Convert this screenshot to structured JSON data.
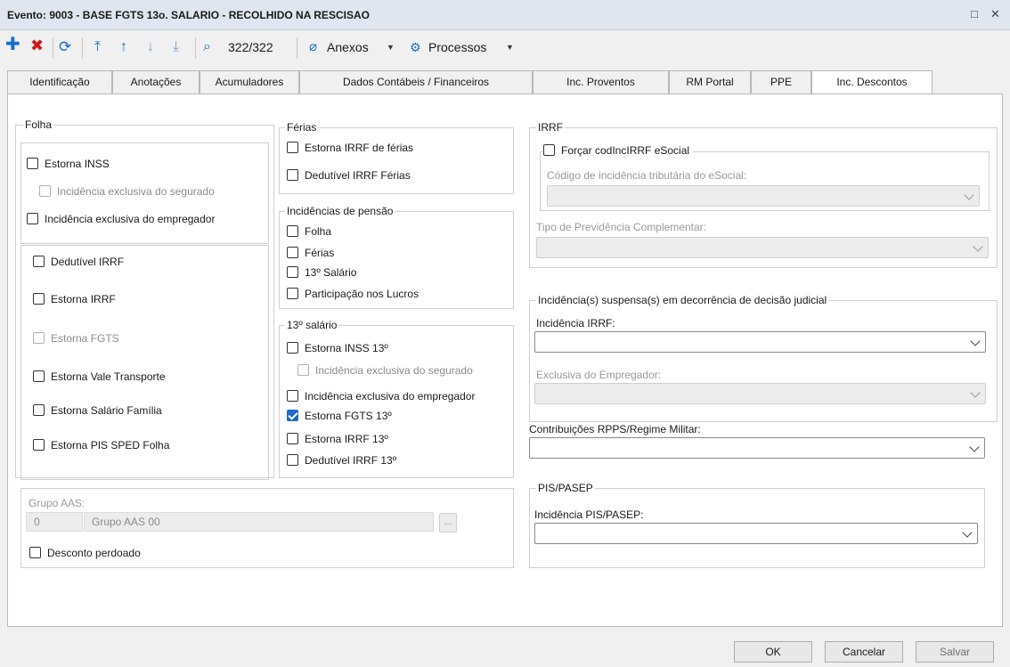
{
  "window": {
    "title": "Evento: 9003 - BASE FGTS 13o. SALARIO - RECOLHIDO NA RESCISAO",
    "maximize_glyph": "□",
    "close_glyph": "✕"
  },
  "toolbar": {
    "record_counter": "322/322",
    "anexos_label": "Anexos",
    "processos_label": "Processos",
    "icons": [
      "add-icon",
      "delete-icon",
      "refresh-icon",
      "first-record-icon",
      "previous-record-icon",
      "next-record-icon",
      "last-record-icon",
      "search-icon",
      "paperclip-icon",
      "gear-icon"
    ]
  },
  "tabs": [
    {
      "label": "Identificação"
    },
    {
      "label": "Anotações"
    },
    {
      "label": "Acumuladores"
    },
    {
      "label": "Dados Contábeis / Financeiros"
    },
    {
      "label": "Inc. Proventos"
    },
    {
      "label": "RM Portal"
    },
    {
      "label": "PPE"
    },
    {
      "label": "Inc. Descontos",
      "active": true
    }
  ],
  "folha": {
    "legend": "Folha",
    "estorna_inss": "Estorna INSS",
    "inc_exclusiva_segurado": "Incidência exclusiva do segurado",
    "inc_exclusiva_empregador": "Incidência exclusiva do empregador",
    "dedutivel_irrf": "Dedutível IRRF",
    "estorna_irrf": "Estorna IRRF",
    "estorna_fgts": "Estorna FGTS",
    "estorna_vale_transporte": "Estorna Vale Transporte",
    "estorna_salario_familia": "Estorna Salário Família",
    "estorna_pis_sped": "Estorna PIS SPED Folha"
  },
  "ferias": {
    "legend": "Férias",
    "estorna_irrf_ferias": "Estorna IRRF de férias",
    "dedutivel_irrf_ferias": "Dedutível IRRF Férias"
  },
  "pensao": {
    "legend": "Incidências de pensão",
    "folha": "Folha",
    "ferias": "Férias",
    "decimo": "13º Salário",
    "plr": "Participação nos Lucros"
  },
  "decimo": {
    "legend": "13º salário",
    "estorna_inss": "Estorna INSS 13º",
    "inc_exclusiva_segurado": "Incidência exclusiva do segurado",
    "inc_exclusiva_empregador": "Incidência exclusiva do empregador",
    "estorna_fgts": "Estorna FGTS 13º",
    "estorna_irrf": "Estorna IRRF 13º",
    "dedutivel_irrf": "Dedutível IRRF 13º"
  },
  "grupo_aas": {
    "label": "Grupo AAS:",
    "code": "0",
    "name": "Grupo AAS 00",
    "ellipsis": "...",
    "desconto_perdoado": "Desconto perdoado"
  },
  "irrf": {
    "legend": "IRRF",
    "forcar": "Forçar codIncIRRF eSocial",
    "codigo_label": "Código de incidência tributária do eSocial:",
    "tipo_previdencia_label": "Tipo de Previdência Complementar:"
  },
  "judicial": {
    "legend": "Incidência(s) suspensa(s) em decorrência de decisão judicial",
    "irrf_label": "Incidência IRRF:",
    "exclusiva_label": "Exclusiva do Empregador:"
  },
  "rpps": {
    "label": "Contribuições RPPS/Regime Militar:"
  },
  "pis": {
    "legend": "PIS/PASEP",
    "label": "Incidência PIS/PASEP:"
  },
  "footer": {
    "ok": "OK",
    "cancel": "Cancelar",
    "save": "Salvar"
  },
  "colors": {
    "accent": "#1b6ac9",
    "delete": "#d11a1a",
    "titlebar": "#dfe6ef"
  }
}
